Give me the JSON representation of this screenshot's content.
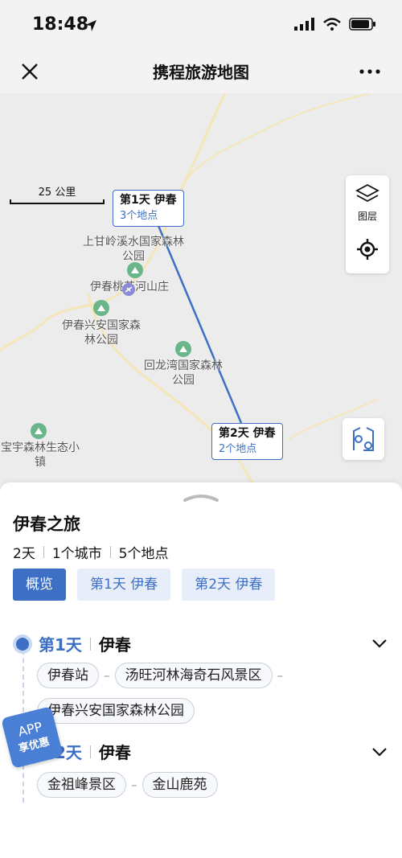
{
  "status": {
    "time": "18:48"
  },
  "nav": {
    "title": "携程旅游地图"
  },
  "map": {
    "scale_label": "25 公里",
    "day1_callout": {
      "title": "第1天 伊春",
      "subtitle": "3个地点"
    },
    "day2_callout": {
      "title": "第2天 伊春",
      "subtitle": "2个地点"
    },
    "pois": {
      "shanganling": "上甘岭溪水国家森林公园",
      "taohua": "伊春桃花河山庄",
      "xingan": "伊春兴安国家森林公园",
      "huilongwan": "回龙湾国家森林公园",
      "baoyu": "宝宇森林生态小镇"
    },
    "layers_label": "图层",
    "route_color": "#3d6fc4"
  },
  "trip": {
    "title": "伊春之旅",
    "days": "2天",
    "cities": "1个城市",
    "places": "5个地点"
  },
  "tabs": [
    {
      "label": "概览"
    },
    {
      "label": "第1天 伊春"
    },
    {
      "label": "第2天 伊春"
    }
  ],
  "itinerary": [
    {
      "day": "第1天",
      "city": "伊春",
      "stops": [
        "伊春站",
        "汤旺河林海奇石风景区",
        "伊春兴安国家森林公园"
      ]
    },
    {
      "day": "第2天",
      "city": "伊春",
      "stops": [
        "金祖峰景区",
        "金山鹿苑"
      ]
    }
  ],
  "badge": {
    "line1": "APP",
    "line2": "享优惠"
  }
}
